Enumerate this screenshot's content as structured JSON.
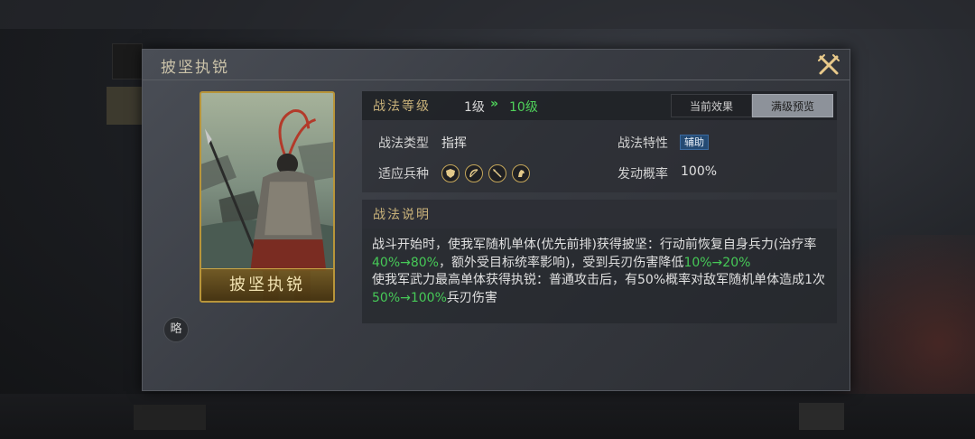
{
  "background": {
    "top_title": "",
    "bottom_left_button": "",
    "bottom_right_button": ""
  },
  "modal": {
    "title": "披坚执锐",
    "close_icon": "crossed-swords-close-icon"
  },
  "card": {
    "name": "披坚执锐",
    "abbr_badge": "略"
  },
  "info": {
    "level_label": "战法等级",
    "level_from": "1级",
    "level_arrow": "»",
    "level_to": "10级",
    "tabs": [
      {
        "label": "当前效果",
        "active": false
      },
      {
        "label": "满级预览",
        "active": true
      }
    ],
    "type_label": "战法类型",
    "type_value": "指挥",
    "trait_label": "战法特性",
    "trait_value": "辅助",
    "troops_label": "适应兵种",
    "troops": [
      "shield-icon",
      "bow-icon",
      "spear-icon",
      "horse-icon"
    ],
    "rate_label": "发动概率",
    "rate_value": "100%"
  },
  "description": {
    "title": "战法说明",
    "p1_a": "战斗开始时，使我军随机单体(优先前排)获得披坚：行动前恢复自身兵力(治疗率",
    "p1_g1": "40%→80%",
    "p1_b": "，额外受目标统率影响)，受到兵刃伤害降低",
    "p1_g2": "10%→20%",
    "p2_a": "使我军武力最高单体获得执锐：普通攻击后，有50%概率对敌军随机单体造成1次",
    "p2_g1": "50%→100%",
    "p2_b": "兵刃伤害"
  },
  "colors": {
    "accent_gold": "#c9b27a",
    "upgrade_green": "#4fd15a",
    "trait_blue": "#244a73"
  }
}
